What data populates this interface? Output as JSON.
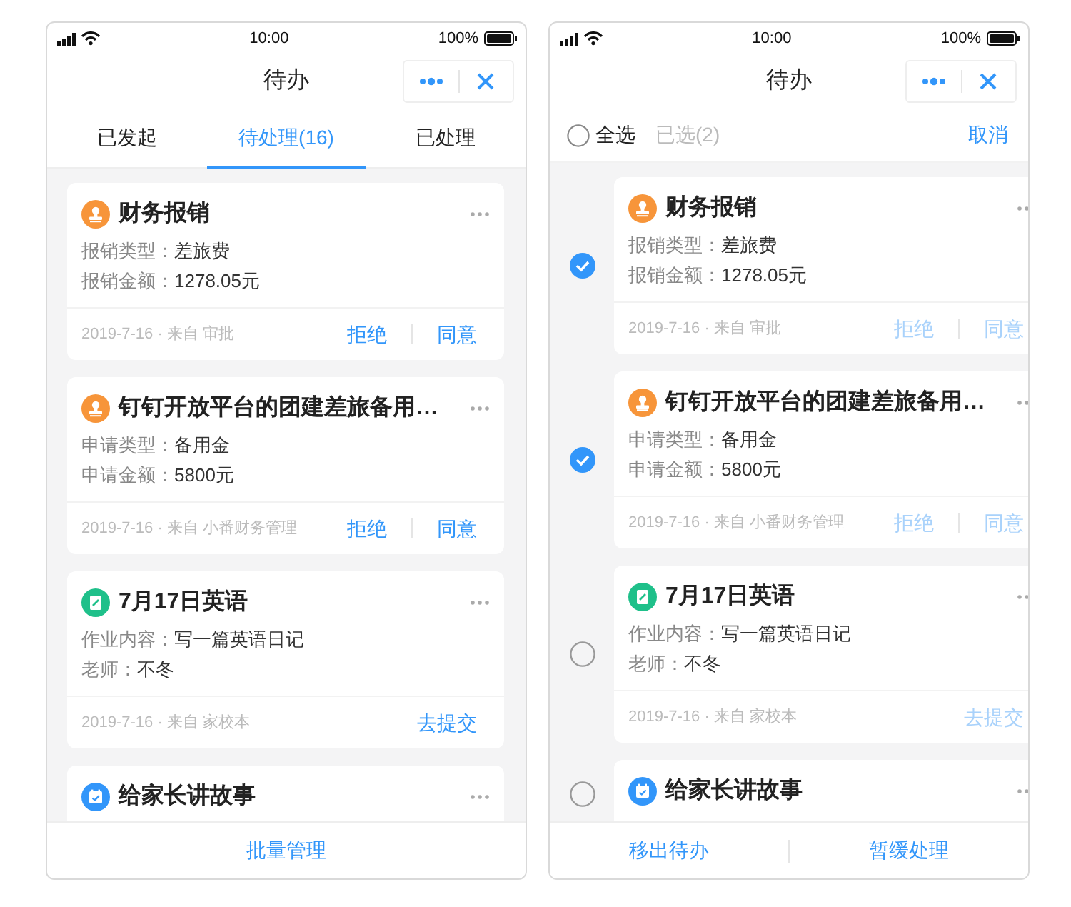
{
  "screens": [
    {
      "status_bar": {
        "time": "10:00",
        "battery": "100%"
      },
      "title": "待办",
      "header": {
        "kind": "tabs",
        "tabs": [
          {
            "label": "已发起",
            "selected": false
          },
          {
            "label": "待处理(16)",
            "selected": true
          },
          {
            "label": "已处理",
            "selected": false
          }
        ]
      },
      "cards": [
        {
          "kind": "stamp",
          "color": "#f7953a",
          "title": "财务报销",
          "fields": [
            {
              "label": "报销类型：",
              "value": "差旅费"
            },
            {
              "label": "报销金额：",
              "value": "1278.05元"
            }
          ],
          "meta": "2019-7-16 · 来自 审批",
          "actions": [
            {
              "label": "拒绝",
              "disabled": false
            },
            {
              "label": "同意",
              "disabled": false
            }
          ]
        },
        {
          "kind": "stamp",
          "color": "#f7953a",
          "title": "钉钉开放平台的团建差旅备用…",
          "fields": [
            {
              "label": "申请类型：",
              "value": "备用金"
            },
            {
              "label": "申请金额：",
              "value": "5800元"
            }
          ],
          "meta": "2019-7-16 · 来自 小番财务管理",
          "actions": [
            {
              "label": "拒绝",
              "disabled": false
            },
            {
              "label": "同意",
              "disabled": false
            }
          ]
        },
        {
          "kind": "homework",
          "color": "#1fc08a",
          "title": "7月17日英语",
          "fields": [
            {
              "label": "作业内容：",
              "value": "写一篇英语日记"
            },
            {
              "label": "老师：",
              "value": "不冬"
            }
          ],
          "meta": "2019-7-16 · 来自 家校本",
          "actions": [
            {
              "label": "去提交",
              "disabled": false
            }
          ]
        },
        {
          "kind": "calendar",
          "color": "#3296fa",
          "title": "给家长讲故事"
        }
      ],
      "footer": [
        {
          "label": "批量管理"
        }
      ]
    },
    {
      "status_bar": {
        "time": "10:00",
        "battery": "100%"
      },
      "title": "待办",
      "header": {
        "kind": "select",
        "select_all": {
          "label": "全选",
          "checked": false
        },
        "count": "已选(2)",
        "cancel": "取消"
      },
      "cards": [
        {
          "selected": true,
          "kind": "stamp",
          "color": "#f7953a",
          "title": "财务报销",
          "fields": [
            {
              "label": "报销类型：",
              "value": "差旅费"
            },
            {
              "label": "报销金额：",
              "value": "1278.05元"
            }
          ],
          "meta": "2019-7-16 · 来自 审批",
          "actions": [
            {
              "label": "拒绝",
              "disabled": true
            },
            {
              "label": "同意",
              "disabled": true
            }
          ]
        },
        {
          "selected": true,
          "kind": "stamp",
          "color": "#f7953a",
          "title": "钉钉开放平台的团建差旅备用…",
          "fields": [
            {
              "label": "申请类型：",
              "value": "备用金"
            },
            {
              "label": "申请金额：",
              "value": "5800元"
            }
          ],
          "meta": "2019-7-16 · 来自 小番财务管理",
          "actions": [
            {
              "label": "拒绝",
              "disabled": true
            },
            {
              "label": "同意",
              "disabled": true
            }
          ]
        },
        {
          "selected": false,
          "kind": "homework",
          "color": "#1fc08a",
          "title": "7月17日英语",
          "fields": [
            {
              "label": "作业内容：",
              "value": "写一篇英语日记"
            },
            {
              "label": "老师：",
              "value": "不冬"
            }
          ],
          "meta": "2019-7-16 · 来自 家校本",
          "actions": [
            {
              "label": "去提交",
              "disabled": true
            }
          ]
        },
        {
          "selected": false,
          "kind": "calendar",
          "color": "#3296fa",
          "title": "给家长讲故事"
        }
      ],
      "footer": [
        {
          "label": "移出待办"
        },
        {
          "label": "暂缓处理"
        }
      ]
    }
  ]
}
